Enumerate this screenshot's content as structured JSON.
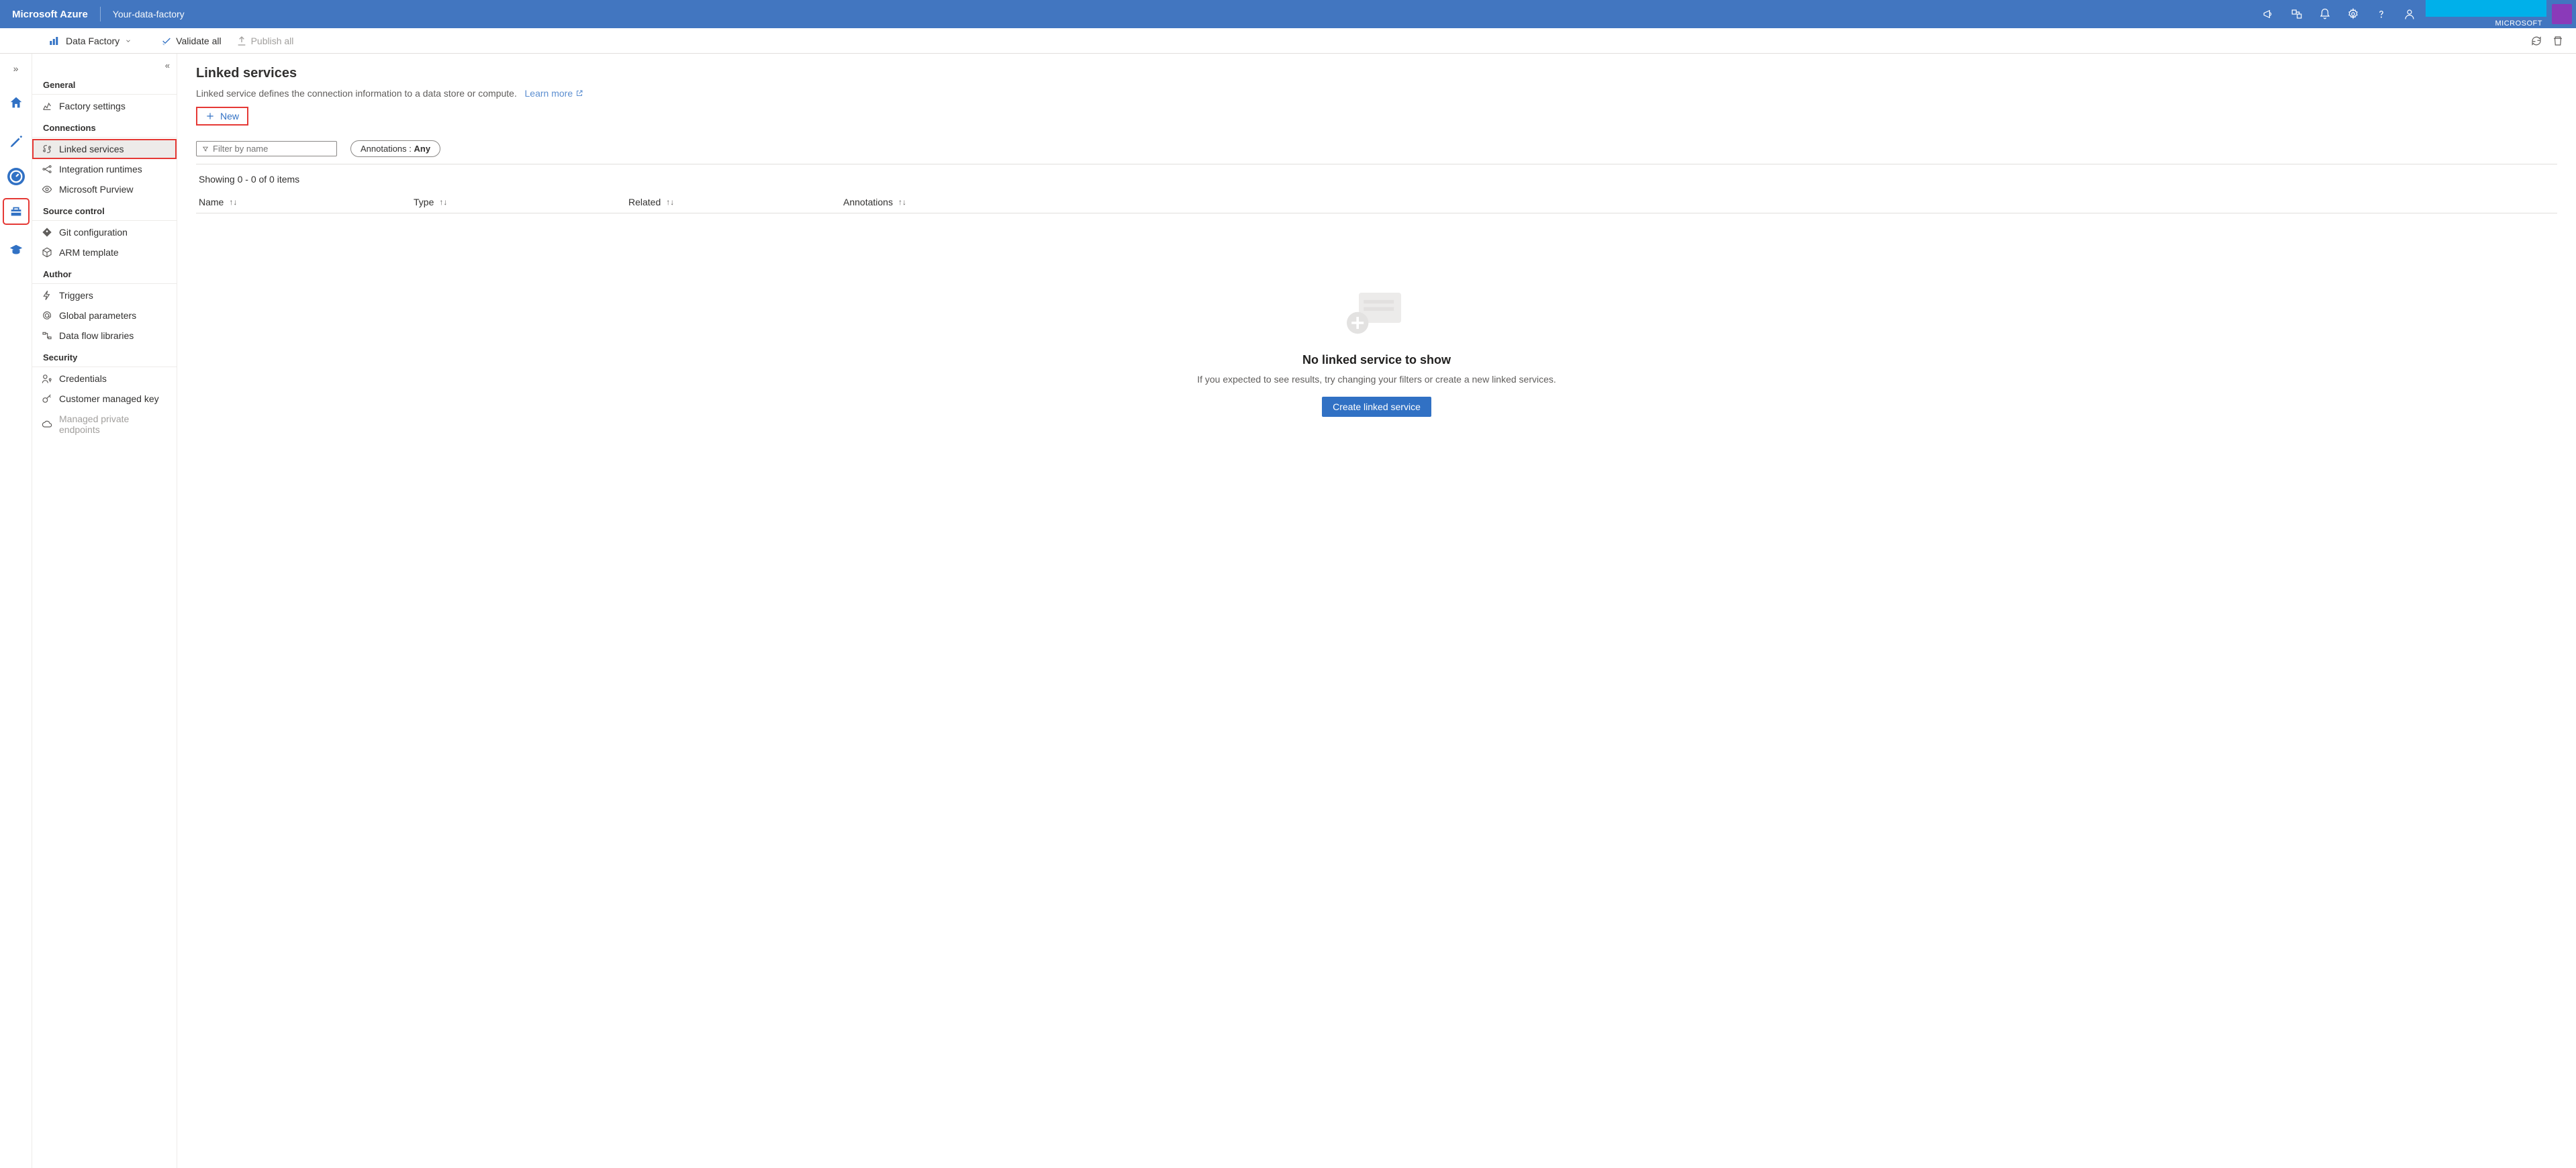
{
  "topbar": {
    "brand": "Microsoft Azure",
    "factory_name": "Your-data-factory",
    "tenant_label": "MICROSOFT"
  },
  "toolbar": {
    "dropdown_label": "Data Factory",
    "validate_label": "Validate all",
    "publish_label": "Publish all"
  },
  "sidepanel": {
    "sections": {
      "general": {
        "header": "General",
        "items": [
          {
            "label": "Factory settings"
          }
        ]
      },
      "connections": {
        "header": "Connections",
        "items": [
          {
            "label": "Linked services"
          },
          {
            "label": "Integration runtimes"
          },
          {
            "label": "Microsoft Purview"
          }
        ]
      },
      "source_control": {
        "header": "Source control",
        "items": [
          {
            "label": "Git configuration"
          },
          {
            "label": "ARM template"
          }
        ]
      },
      "author": {
        "header": "Author",
        "items": [
          {
            "label": "Triggers"
          },
          {
            "label": "Global parameters"
          },
          {
            "label": "Data flow libraries"
          }
        ]
      },
      "security": {
        "header": "Security",
        "items": [
          {
            "label": "Credentials"
          },
          {
            "label": "Customer managed key"
          },
          {
            "label": "Managed private endpoints"
          }
        ]
      }
    }
  },
  "main": {
    "title": "Linked services",
    "description": "Linked service defines the connection information to a data store or compute.",
    "learn_more": "Learn more",
    "new_button": "New",
    "filter_placeholder": "Filter by name",
    "annotations_label": "Annotations : ",
    "annotations_value": "Any",
    "showing_text": "Showing 0 - 0 of 0 items",
    "columns": {
      "name": "Name",
      "type": "Type",
      "related": "Related",
      "annotations": "Annotations"
    },
    "empty": {
      "title": "No linked service to show",
      "subtitle": "If you expected to see results, try changing your filters or create a new linked services.",
      "button": "Create linked service"
    }
  }
}
